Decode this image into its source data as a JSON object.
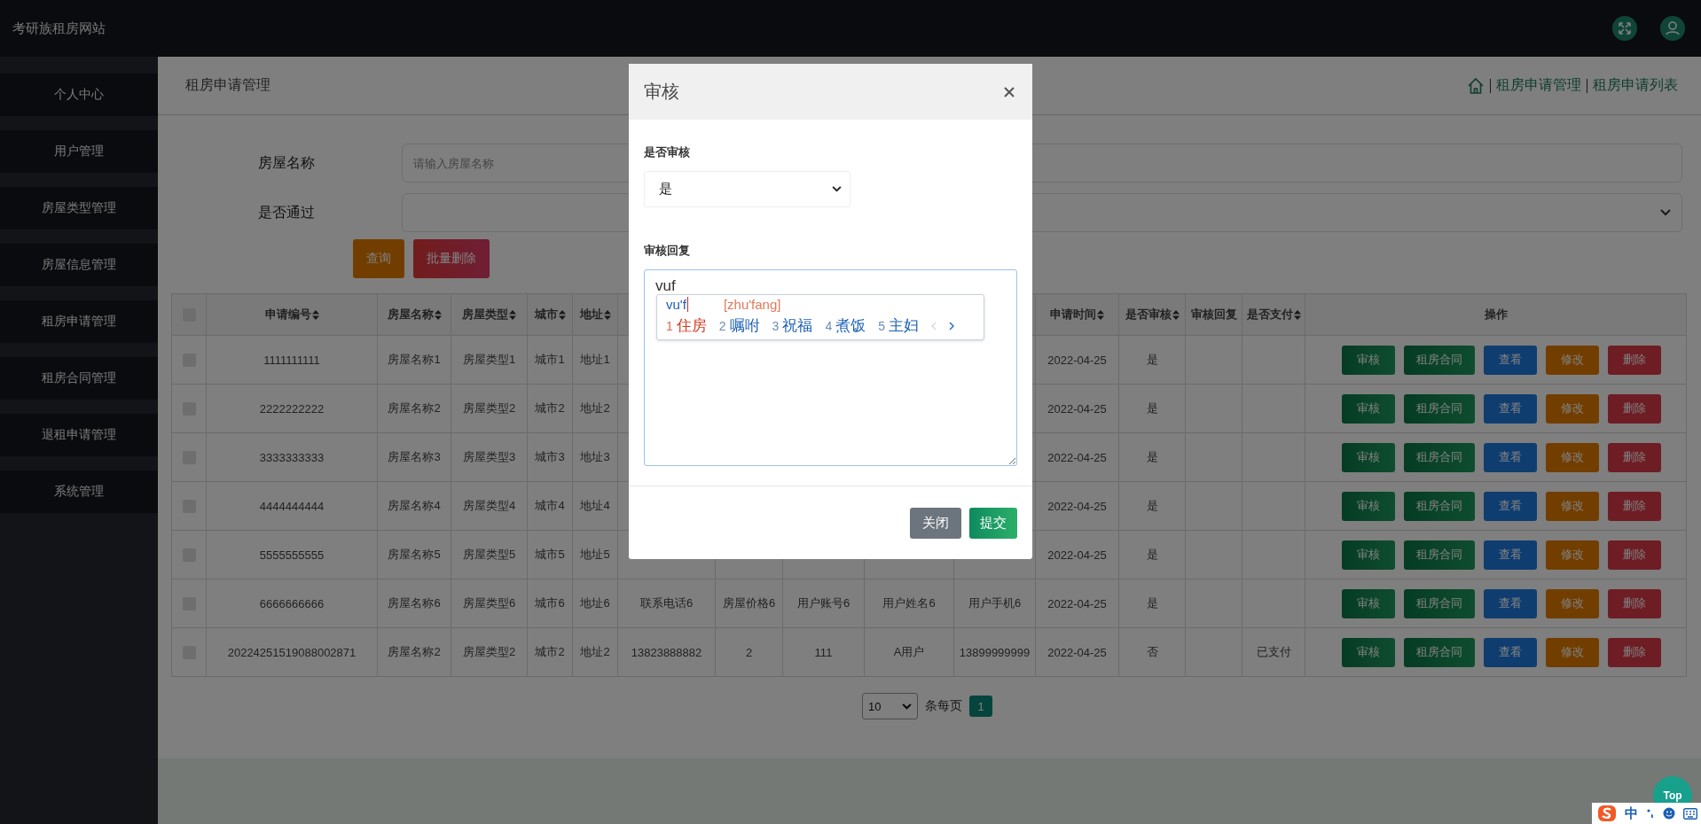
{
  "site_title": "考研族租房网站",
  "sidebar": {
    "items": [
      {
        "label": "个人中心"
      },
      {
        "label": "用户管理"
      },
      {
        "label": "房屋类型管理"
      },
      {
        "label": "房屋信息管理"
      },
      {
        "label": "租房申请管理"
      },
      {
        "label": "租房合同管理"
      },
      {
        "label": "退租申请管理"
      },
      {
        "label": "系统管理"
      }
    ]
  },
  "page_title": "租房申请管理",
  "breadcrumb": [
    "租房申请管理",
    "租房申请列表"
  ],
  "filters": [
    {
      "label": "房屋名称",
      "kind": "input",
      "placeholder": "请输入房屋名称"
    },
    {
      "label": "是否通过",
      "kind": "select"
    }
  ],
  "filter_buttons": [
    {
      "label": "查询",
      "kind": "search"
    },
    {
      "label": "批量删除",
      "kind": "delete"
    }
  ],
  "table": {
    "header_checked": false,
    "columns": [
      {
        "label": "申请编号",
        "sortable": true
      },
      {
        "label": "房屋名称",
        "sortable": true
      },
      {
        "label": "房屋类型",
        "sortable": true
      },
      {
        "label": "城市",
        "sortable": true
      },
      {
        "label": "地址",
        "sortable": true
      },
      {},
      {},
      {},
      {},
      {},
      {
        "label": "申请时间",
        "sortable": true
      },
      {
        "label": "是否审核",
        "sortable": true
      },
      {
        "label": "审核回复",
        "sortable": false
      },
      {
        "label": "是否支付",
        "sortable": true
      },
      {
        "label": "操作",
        "sortable": false
      }
    ],
    "rows": [
      {
        "checked": false,
        "cells": [
          "1111111111",
          "房屋名称1",
          "房屋类型1",
          "城市1",
          "地址1",
          null,
          null,
          null,
          null,
          null,
          "2022-04-25",
          "是",
          null,
          null
        ],
        "actions": [
          {
            "label": "审核",
            "kind": "audit"
          },
          {
            "label": "租房合同",
            "kind": "contract"
          },
          {
            "label": "查看",
            "kind": "view"
          },
          {
            "label": "修改",
            "kind": "edit"
          },
          {
            "label": "删除",
            "kind": "delete"
          }
        ]
      },
      {
        "checked": false,
        "cells": [
          "2222222222",
          "房屋名称2",
          "房屋类型2",
          "城市2",
          "地址2",
          null,
          null,
          null,
          null,
          null,
          "2022-04-25",
          "是",
          null,
          null
        ],
        "actions": [
          {
            "label": "审核",
            "kind": "audit"
          },
          {
            "label": "租房合同",
            "kind": "contract"
          },
          {
            "label": "查看",
            "kind": "view"
          },
          {
            "label": "修改",
            "kind": "edit"
          },
          {
            "label": "删除",
            "kind": "delete"
          }
        ]
      },
      {
        "checked": false,
        "cells": [
          "3333333333",
          "房屋名称3",
          "房屋类型3",
          "城市3",
          "地址3",
          null,
          null,
          null,
          null,
          null,
          "2022-04-25",
          "是",
          null,
          null
        ],
        "actions": [
          {
            "label": "审核",
            "kind": "audit"
          },
          {
            "label": "租房合同",
            "kind": "contract"
          },
          {
            "label": "查看",
            "kind": "view"
          },
          {
            "label": "修改",
            "kind": "edit"
          },
          {
            "label": "删除",
            "kind": "delete"
          }
        ]
      },
      {
        "checked": false,
        "cells": [
          "4444444444",
          "房屋名称4",
          "房屋类型4",
          "城市4",
          "地址4",
          null,
          null,
          null,
          null,
          null,
          "2022-04-25",
          "是",
          null,
          null
        ],
        "actions": [
          {
            "label": "审核",
            "kind": "audit"
          },
          {
            "label": "租房合同",
            "kind": "contract"
          },
          {
            "label": "查看",
            "kind": "view"
          },
          {
            "label": "修改",
            "kind": "edit"
          },
          {
            "label": "删除",
            "kind": "delete"
          }
        ]
      },
      {
        "checked": false,
        "cells": [
          "5555555555",
          "房屋名称5",
          "房屋类型5",
          "城市5",
          "地址5",
          null,
          null,
          null,
          null,
          null,
          "2022-04-25",
          "是",
          null,
          null
        ],
        "actions": [
          {
            "label": "审核",
            "kind": "audit"
          },
          {
            "label": "租房合同",
            "kind": "contract"
          },
          {
            "label": "查看",
            "kind": "view"
          },
          {
            "label": "修改",
            "kind": "edit"
          },
          {
            "label": "删除",
            "kind": "delete"
          }
        ]
      },
      {
        "checked": false,
        "cells": [
          "6666666666",
          "房屋名称6",
          "房屋类型6",
          "城市6",
          "地址6",
          "联系电话6",
          "房屋价格6",
          "用户账号6",
          "用户姓名6",
          "用户手机6",
          "2022-04-25",
          "是",
          null,
          null
        ],
        "actions": [
          {
            "label": "审核",
            "kind": "audit"
          },
          {
            "label": "租房合同",
            "kind": "contract"
          },
          {
            "label": "查看",
            "kind": "view"
          },
          {
            "label": "修改",
            "kind": "edit"
          },
          {
            "label": "删除",
            "kind": "delete"
          }
        ]
      },
      {
        "checked": false,
        "cells": [
          "20224251519088002871",
          "房屋名称2",
          "房屋类型2",
          "城市2",
          "地址2",
          "13823888882",
          "2",
          "111",
          "A用户",
          "13899999999",
          "2022-04-25",
          "否",
          null,
          "已支付"
        ],
        "actions": [
          {
            "label": "审核",
            "kind": "audit"
          },
          {
            "label": "租房合同",
            "kind": "contract"
          },
          {
            "label": "查看",
            "kind": "view"
          },
          {
            "label": "修改",
            "kind": "edit"
          },
          {
            "label": "删除",
            "kind": "delete"
          }
        ]
      }
    ]
  },
  "pagination": {
    "page_size": "10",
    "page_size_label": "条每页",
    "pages": [
      {
        "label": "1",
        "selected": true
      }
    ]
  },
  "modal": {
    "title": "审核",
    "fields": [
      {
        "label": "是否审核",
        "kind": "select",
        "value": "是"
      },
      {
        "label": "审核回复",
        "kind": "textarea",
        "value": "vuf"
      }
    ],
    "buttons": [
      {
        "label": "关闭",
        "kind": "close"
      },
      {
        "label": "提交",
        "kind": "submit"
      }
    ]
  },
  "ime": {
    "composition": "vu'f",
    "pinyin": "[zhu'fang]",
    "candidates": [
      {
        "number": "1",
        "word": "住房",
        "selected": true
      },
      {
        "number": "2",
        "word": "嘱咐",
        "selected": false
      },
      {
        "number": "3",
        "word": "祝福",
        "selected": false
      },
      {
        "number": "4",
        "word": "煮饭",
        "selected": false
      },
      {
        "number": "5",
        "word": "主妇",
        "selected": false
      }
    ],
    "mode": "中"
  },
  "top_button": "Top"
}
